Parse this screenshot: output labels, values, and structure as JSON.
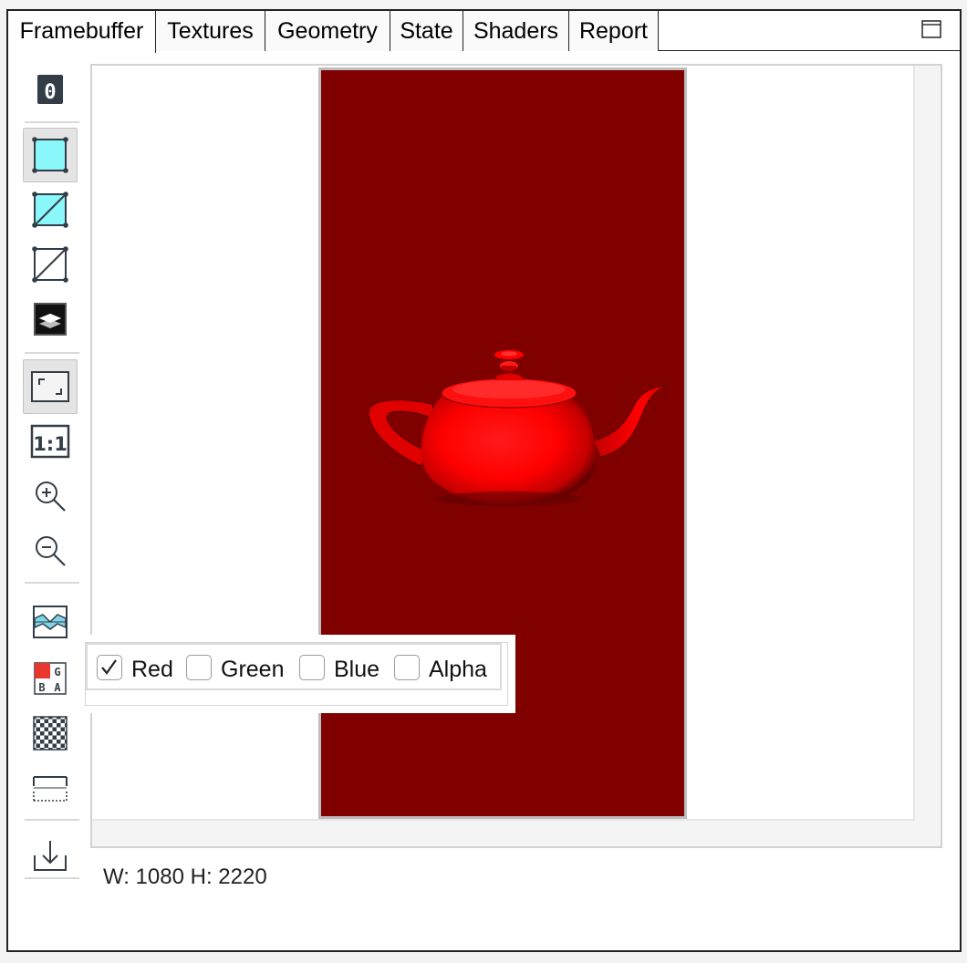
{
  "tabs": [
    {
      "label": "Framebuffer",
      "active": true
    },
    {
      "label": "Textures",
      "active": false
    },
    {
      "label": "Geometry",
      "active": false
    },
    {
      "label": "State",
      "active": false
    },
    {
      "label": "Shaders",
      "active": false
    },
    {
      "label": "Report",
      "active": false
    }
  ],
  "toolbar": {
    "attachment_index": "0",
    "zoom_actual_label": "1:1",
    "channel_icon_letters": [
      "G",
      "B",
      "A"
    ],
    "tools": [
      {
        "name": "attachment-icon",
        "pressed": false
      },
      {
        "name": "render-shaded-icon",
        "pressed": true
      },
      {
        "name": "render-shaded-wireframe-icon",
        "pressed": false
      },
      {
        "name": "render-wireframe-icon",
        "pressed": false
      },
      {
        "name": "render-overdraw-icon",
        "pressed": false
      },
      {
        "name": "zoom-fit-icon",
        "pressed": true
      },
      {
        "name": "zoom-actual-icon",
        "pressed": false
      },
      {
        "name": "zoom-in-icon",
        "pressed": false
      },
      {
        "name": "zoom-out-icon",
        "pressed": false
      },
      {
        "name": "histogram-icon",
        "pressed": false
      },
      {
        "name": "color-channels-icon",
        "pressed": false
      },
      {
        "name": "checkerboard-icon",
        "pressed": false
      },
      {
        "name": "flip-vertical-icon",
        "pressed": false
      },
      {
        "name": "save-icon",
        "pressed": false
      }
    ]
  },
  "channels": [
    {
      "label": "Red",
      "checked": true
    },
    {
      "label": "Green",
      "checked": false
    },
    {
      "label": "Blue",
      "checked": false
    },
    {
      "label": "Alpha",
      "checked": false
    }
  ],
  "status": {
    "dimensions": "W: 1080 H: 2220"
  },
  "colors": {
    "background": "#800000",
    "teapot": "#ff0000",
    "icon_accent": "#8af7fa",
    "icon_dark": "#333d47"
  }
}
